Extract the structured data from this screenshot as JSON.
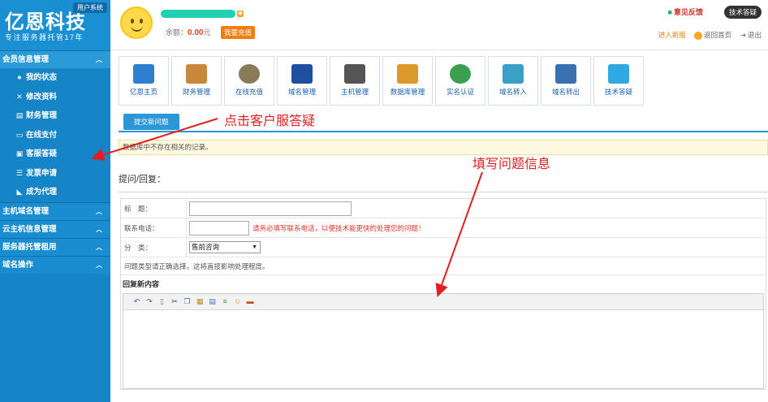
{
  "sidebar": {
    "logo_title": "亿恩科技",
    "logo_sub": "专注服务器托管17年",
    "user_system": "用户系统",
    "section_member": "会员信息管理",
    "items": [
      {
        "label": "我的状态",
        "icon": "user-icon"
      },
      {
        "label": "修改资料",
        "icon": "tools-icon"
      },
      {
        "label": "财务管理",
        "icon": "database-icon"
      },
      {
        "label": "在线支付",
        "icon": "card-icon"
      },
      {
        "label": "客服答疑",
        "icon": "chat-icon"
      },
      {
        "label": "发票申请",
        "icon": "list-icon"
      },
      {
        "label": "成为代理",
        "icon": "bird-icon"
      }
    ],
    "sections": [
      "主机域名管理",
      "云主机信息管理",
      "服务器托管租用",
      "域名操作"
    ]
  },
  "header": {
    "balance_label": "余额：",
    "balance_value": "0.00",
    "balance_unit": "元",
    "recharge": "我要充值",
    "feedback": "意见反馈",
    "support": "技术答疑",
    "new_version": "进入新版",
    "home": "返回首页",
    "logout": "退出"
  },
  "iconbar": [
    {
      "label": "亿恩主页",
      "icon": "monitor-icon",
      "color": "#2f7fd0"
    },
    {
      "label": "财务管理",
      "icon": "briefcase-icon",
      "color": "#c8873a"
    },
    {
      "label": "在线充值",
      "icon": "money-bag-icon",
      "color": "#8a7a5a"
    },
    {
      "label": "域名管理",
      "icon": "flag-icon",
      "color": "#1f4fa0"
    },
    {
      "label": "主机管理",
      "icon": "server-icon",
      "color": "#555555"
    },
    {
      "label": "数据库管理",
      "icon": "database-tree-icon",
      "color": "#d99a2a"
    },
    {
      "label": "实名认证",
      "icon": "users-icon",
      "color": "#3aa050"
    },
    {
      "label": "域名转入",
      "icon": "transfer-in-icon",
      "color": "#3aa0c8"
    },
    {
      "label": "域名转出",
      "icon": "transfer-out-icon",
      "color": "#3a6fb0"
    },
    {
      "label": "技术答疑",
      "icon": "speech-bubble-icon",
      "color": "#2fa9e0"
    }
  ],
  "content": {
    "new_question_button": "提交新问题",
    "notice": "数据库中不存在相关的记录。",
    "section_title": "提问/回复：",
    "form": {
      "title_label": "标　题：",
      "phone_label": "联系电话：",
      "phone_hint": "请务必填写联系电话，以便技术能更快的处理您的问题！",
      "category_label": "分　类：",
      "category_selected": "售前咨询",
      "category_note": "问题类型请正确选择，这将直接影响处理程度。",
      "reply_title": "回复新内容"
    }
  },
  "annotations": {
    "click_support": "点击客户服答疑",
    "fill_info": "填写问题信息"
  }
}
